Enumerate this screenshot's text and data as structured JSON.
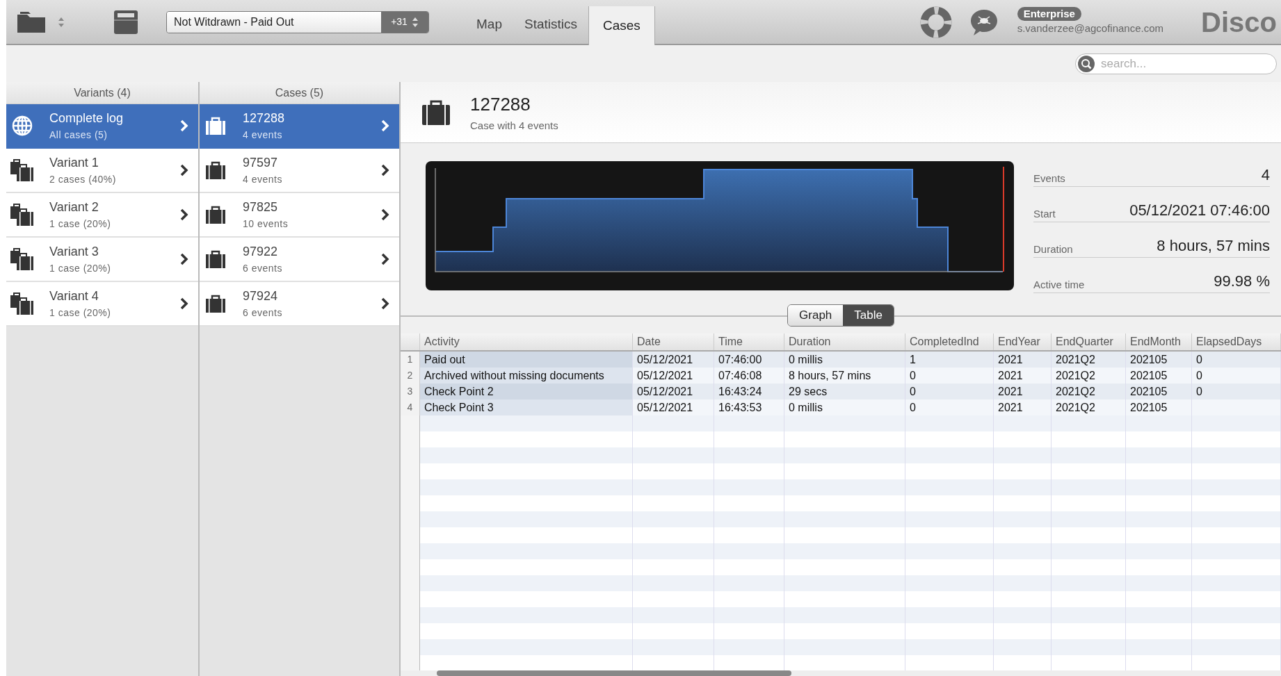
{
  "toolbar": {
    "filter": {
      "label": "Not Witdrawn - Paid Out",
      "count": "+31"
    },
    "tabs": [
      {
        "label": "Map",
        "selected": false
      },
      {
        "label": "Statistics",
        "selected": false
      },
      {
        "label": "Cases",
        "selected": true
      }
    ],
    "license_badge": "Enterprise",
    "user_email": "s.vanderzee@agcofinance.com",
    "logo": "Disco"
  },
  "search": {
    "placeholder": "search..."
  },
  "variants": {
    "title": "Variants (4)",
    "items": [
      {
        "kind": "all",
        "title": "Complete log",
        "subtitle": "All cases (5)",
        "selected": true
      },
      {
        "kind": "variant",
        "title": "Variant 1",
        "subtitle": "2 cases (40%)",
        "selected": false
      },
      {
        "kind": "variant",
        "title": "Variant 2",
        "subtitle": "1 case (20%)",
        "selected": false
      },
      {
        "kind": "variant",
        "title": "Variant 3",
        "subtitle": "1 case (20%)",
        "selected": false
      },
      {
        "kind": "variant",
        "title": "Variant 4",
        "subtitle": "1 case (20%)",
        "selected": false
      }
    ]
  },
  "cases": {
    "title": "Cases (5)",
    "items": [
      {
        "title": "127288",
        "subtitle": "4 events",
        "selected": true
      },
      {
        "title": "97597",
        "subtitle": "4 events",
        "selected": false
      },
      {
        "title": "97825",
        "subtitle": "10 events",
        "selected": false
      },
      {
        "title": "97922",
        "subtitle": "6 events",
        "selected": false
      },
      {
        "title": "97924",
        "subtitle": "6 events",
        "selected": false
      }
    ]
  },
  "case_detail": {
    "title": "127288",
    "subtitle": "Case with 4 events",
    "stats": [
      {
        "label": "Events",
        "value": "4"
      },
      {
        "label": "Start",
        "value": "05/12/2021 07:46:00"
      },
      {
        "label": "Duration",
        "value": "8 hours, 57 mins"
      },
      {
        "label": "Active time",
        "value": "99.98 %"
      }
    ],
    "view_toggle": [
      {
        "label": "Graph",
        "selected": false
      },
      {
        "label": "Table",
        "selected": true
      }
    ],
    "table": {
      "columns": [
        "Activity",
        "Date",
        "Time",
        "Duration",
        "CompletedInd",
        "EndYear",
        "EndQuarter",
        "EndMonth",
        "ElapsedDays"
      ],
      "rows": [
        {
          "index": "1",
          "cells": [
            "Paid out",
            "05/12/2021",
            "07:46:00",
            "0 millis",
            "1",
            "2021",
            "2021Q2",
            "202105",
            "0"
          ]
        },
        {
          "index": "2",
          "cells": [
            "Archived without missing documents",
            "05/12/2021",
            "07:46:08",
            "8 hours, 57 mins",
            "0",
            "2021",
            "2021Q2",
            "202105",
            "0"
          ]
        },
        {
          "index": "3",
          "cells": [
            "Check Point 2",
            "05/12/2021",
            "16:43:24",
            "29 secs",
            "0",
            "2021",
            "2021Q2",
            "202105",
            "0"
          ]
        },
        {
          "index": "4",
          "cells": [
            "Check Point 3",
            "05/12/2021",
            "16:43:53",
            "0 millis",
            "0",
            "2021",
            "2021Q2",
            "202105",
            ""
          ]
        }
      ]
    }
  }
}
